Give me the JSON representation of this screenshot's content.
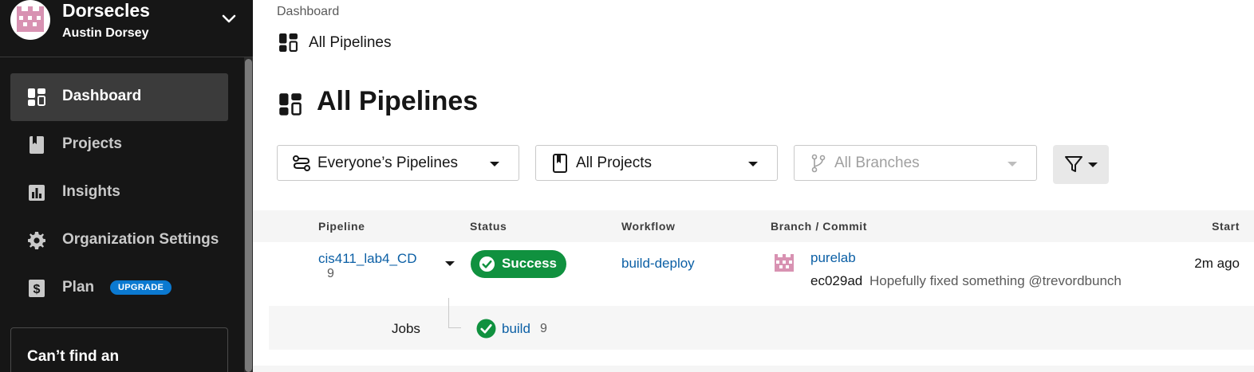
{
  "org": {
    "name": "Dorsecles",
    "user": "Austin Dorsey"
  },
  "sidebar": {
    "items": [
      {
        "label": "Dashboard",
        "icon": "dashboard-icon",
        "active": true
      },
      {
        "label": "Projects",
        "icon": "book-icon"
      },
      {
        "label": "Insights",
        "icon": "bar-chart-icon"
      },
      {
        "label": "Organization Settings",
        "icon": "gear-icon"
      },
      {
        "label": "Plan",
        "icon": "dollar-icon",
        "badge": "UPGRADE"
      }
    ],
    "promo_text": "Can’t find an"
  },
  "breadcrumb": {
    "root": "Dashboard",
    "current": "All Pipelines"
  },
  "page": {
    "title": "All Pipelines"
  },
  "filters": {
    "pipelines": "Everyone’s Pipelines",
    "projects": "All Projects",
    "branches": "All Branches"
  },
  "table": {
    "headers": {
      "pipeline": "Pipeline",
      "status": "Status",
      "workflow": "Workflow",
      "branch_commit": "Branch / Commit",
      "start": "Start"
    },
    "row": {
      "pipeline": "cis411_lab4_CD",
      "number": "9",
      "status": "Success",
      "workflow": "build-deploy",
      "branch": "purelab",
      "sha": "ec029ad",
      "message": "Hopefully fixed something @trevordbunch",
      "start": "2m ago"
    },
    "jobs": {
      "label": "Jobs",
      "name": "build",
      "number": "9"
    }
  },
  "colors": {
    "sidebar_bg": "#161616",
    "success": "#10913f",
    "link": "#0b5fa5",
    "upgrade": "#0b79d0"
  }
}
